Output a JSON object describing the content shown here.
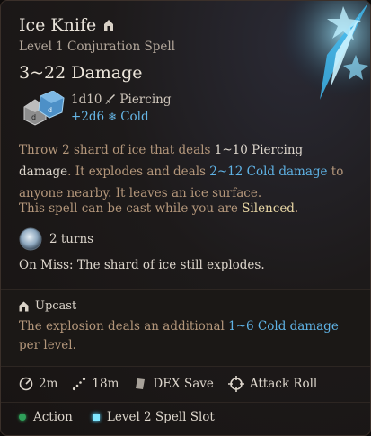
{
  "spell": {
    "name": "Ice Knife",
    "subtitle": "Level 1 Conjuration Spell",
    "damage_summary": "3~22 Damage"
  },
  "rolls": [
    {
      "dice": "1d10",
      "type": "Piercing",
      "icon": "dagger-icon"
    },
    {
      "dice": "+2d6",
      "type": "Cold",
      "icon": "snowflake-icon"
    }
  ],
  "description": {
    "p1": "Throw 2 shard of ice that deals ",
    "p1_dmg": "1~10 Piercing damage",
    "p1_mid": ". It explodes and deals ",
    "p1_cold": "2~12 Cold damage",
    "p1_end": " to anyone nearby. It leaves an ice surface.",
    "silenced_pre": "This spell can be cast while you are ",
    "silenced_word": "Silenced",
    "silenced_end": "."
  },
  "duration": {
    "label": "2 turns",
    "icon": "ice-surface-icon"
  },
  "on_miss": "On Miss: The shard of ice still explodes.",
  "upcast": {
    "title": "Upcast",
    "text_pre": "The explosion deals an additional ",
    "text_dmg": "1~6 Cold damage",
    "text_end": " per level."
  },
  "stats": [
    {
      "label": "2m",
      "icon": "radius-icon"
    },
    {
      "label": "18m",
      "icon": "range-icon"
    },
    {
      "label": "DEX Save",
      "icon": "save-icon"
    },
    {
      "label": "Attack Roll",
      "icon": "crosshair-icon"
    }
  ],
  "costs": [
    {
      "label": "Action",
      "icon": "action-dot-icon"
    },
    {
      "label": "Level 2 Spell Slot",
      "icon": "spell-slot-icon"
    }
  ],
  "colors": {
    "accent_blue": "#5fb3e6",
    "highlight_yellow": "#ead8a6",
    "action_green": "#2fa05a"
  }
}
